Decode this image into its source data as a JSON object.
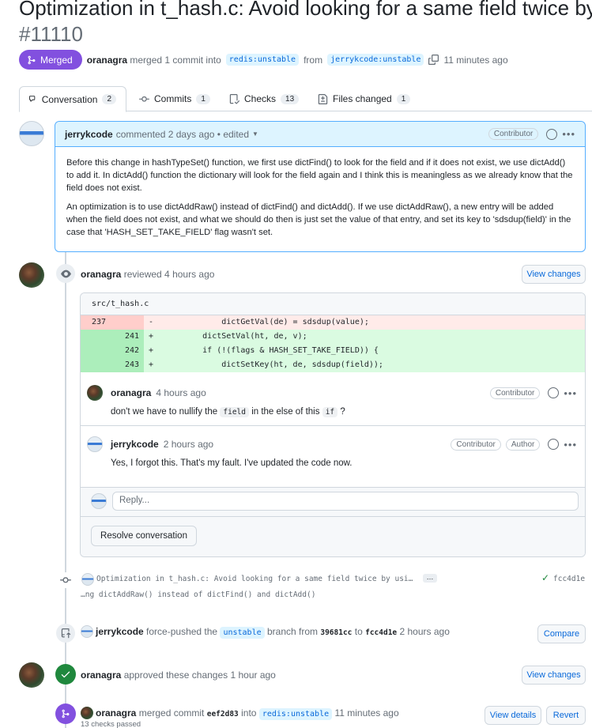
{
  "pr": {
    "title": "Optimization in t_hash.c: Avoid looking for a same field twice by",
    "number": "#11110",
    "status": "Merged",
    "author": "oranagra",
    "merge_text": "merged 1 commit into",
    "base_branch": "redis:unstable",
    "from_text": "from",
    "head_branch": "jerrykcode:unstable",
    "time": "11 minutes ago"
  },
  "tabs": [
    {
      "label": "Conversation",
      "count": "2"
    },
    {
      "label": "Commits",
      "count": "1"
    },
    {
      "label": "Checks",
      "count": "13"
    },
    {
      "label": "Files changed",
      "count": "1"
    }
  ],
  "first_comment": {
    "author": "jerrykcode",
    "meta": "commented 2 days ago • edited",
    "badge": "Contributor",
    "paragraphs": [
      "Before this change in hashTypeSet() function, we first use dictFind() to look for the field and if it does not exist, we use dictAdd() to add it. In dictAdd() function the dictionary will look for the field again and I think this is meaningless as we already know that the field does not exist.",
      "An optimization is to use dictAddRaw() instead of dictFind() and dictAdd(). If we use dictAddRaw(), a new entry will be added when the field does not exist, and what we should do then is just set the value of that entry, and set its key to 'sdsdup(field)' in the case that 'HASH_SET_TAKE_FIELD' flag wasn't set."
    ]
  },
  "review": {
    "author": "oranagra",
    "action": "reviewed 4 hours ago",
    "view_changes": "View changes",
    "file": "src/t_hash.c",
    "diff": [
      {
        "type": "del",
        "old": "237",
        "new": "",
        "sign": "-",
        "code": "            dictGetVal(de) = sdsdup(value);"
      },
      {
        "type": "add",
        "old": "",
        "new": "241",
        "sign": "+",
        "code": "        dictSetVal(ht, de, v);"
      },
      {
        "type": "add",
        "old": "",
        "new": "242",
        "sign": "+",
        "code": "        if (!(flags & HASH_SET_TAKE_FIELD)) {"
      },
      {
        "type": "add",
        "old": "",
        "new": "243",
        "sign": "+",
        "code": "            dictSetKey(ht, de, sdsdup(field));"
      }
    ],
    "comments": [
      {
        "author": "oranagra",
        "time": "4 hours ago",
        "badges": [
          "Contributor"
        ],
        "text_a": "don't we have to nullify the",
        "code_a": "field",
        "text_b": "in the else of this",
        "code_b": "if",
        "text_c": "?"
      },
      {
        "author": "jerrykcode",
        "time": "2 hours ago",
        "badges": [
          "Contributor",
          "Author"
        ],
        "text": "Yes, I forgot this. That's my fault. I've updated the code now."
      }
    ],
    "reply_placeholder": "Reply...",
    "resolve_label": "Resolve conversation"
  },
  "commit_event": {
    "message": "Optimization in t_hash.c: Avoid looking for a same field twice by usi…",
    "message_cont": "…ng dictAddRaw() instead of dictFind() and dictAdd()",
    "ellipsis": "…",
    "sha": "fcc4d1e"
  },
  "force_push": {
    "author": "jerrykcode",
    "text_a": "force-pushed the",
    "branch": "unstable",
    "text_b": "branch from",
    "from_sha": "39681cc",
    "text_c": "to",
    "to_sha": "fcc4d1e",
    "time": "2 hours ago",
    "button": "Compare"
  },
  "approval": {
    "author": "oranagra",
    "text": "approved these changes 1 hour ago",
    "button": "View changes"
  },
  "merge_event": {
    "author": "oranagra",
    "text_a": "merged commit",
    "sha": "eef2d83",
    "text_b": "into",
    "branch": "redis:unstable",
    "time": "11 minutes ago",
    "checks": "13 checks passed",
    "view_details": "View details",
    "revert": "Revert"
  },
  "colors": {
    "merged": "#8250df",
    "approved": "#1f883d",
    "link": "#0969da",
    "highlight_border": "#54aeff"
  }
}
